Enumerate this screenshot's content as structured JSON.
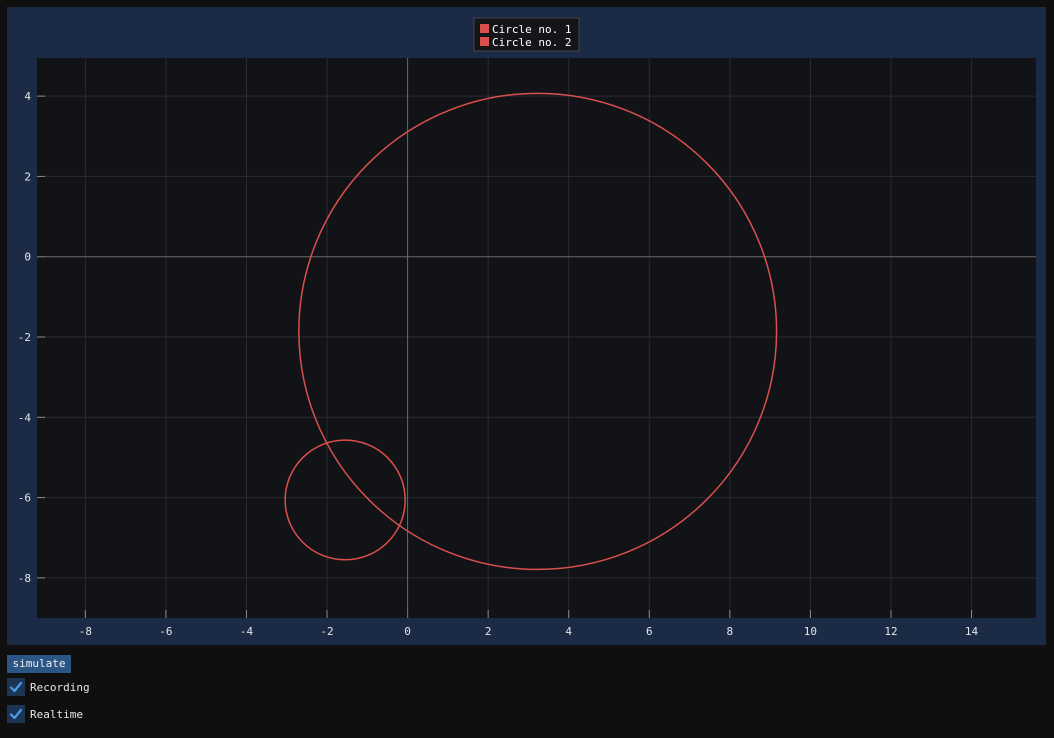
{
  "controls": {
    "simulate_label": "simulate",
    "recording_label": "Recording",
    "recording_checked": true,
    "realtime_label": "Realtime",
    "realtime_checked": true
  },
  "colors": {
    "plot_frame": "#1c2b45",
    "plot_area": "#121316",
    "series": "#d9504d",
    "button": "#2a5585",
    "checkbox": "#1c3554",
    "checkmark": "#4e9ce8"
  },
  "chart_data": {
    "type": "line",
    "title": "",
    "xlabel": "",
    "ylabel": "",
    "xlim": [
      -9.2,
      15.6
    ],
    "ylim": [
      -9.0,
      4.95
    ],
    "x_ticks": [
      -8,
      -6,
      -4,
      -2,
      0,
      2,
      4,
      6,
      8,
      10,
      12,
      14
    ],
    "y_ticks": [
      4,
      2,
      0,
      -2,
      -4,
      -6,
      -8
    ],
    "grid": true,
    "legend_position": "top-center",
    "series": [
      {
        "name": "Circle no. 1",
        "shape": "circle",
        "center": [
          3.23,
          -1.86
        ],
        "radius": 5.93
      },
      {
        "name": "Circle no. 2",
        "shape": "circle",
        "center": [
          -1.55,
          -6.06
        ],
        "radius": 1.49
      }
    ]
  }
}
